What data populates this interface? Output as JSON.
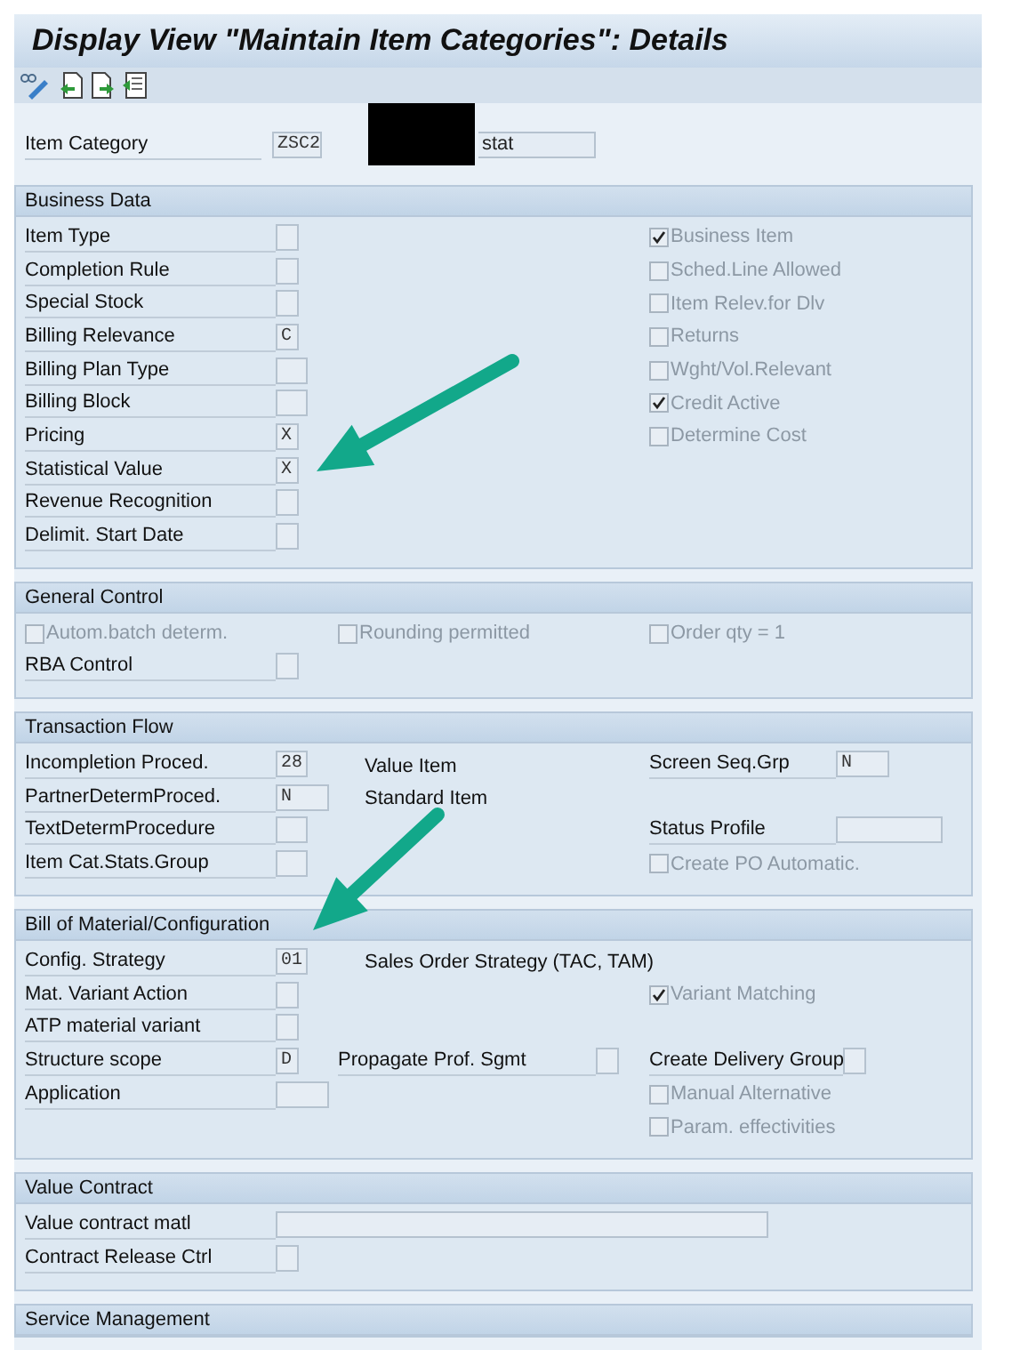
{
  "title": "Display View \"Maintain Item Categories\": Details",
  "item_category": {
    "label": "Item Category",
    "value": "ZSC2",
    "description": "stat"
  },
  "sections": [
    {
      "title": "Business Data",
      "rows": [
        {
          "left": {
            "kind": "flag",
            "label": "Item Type"
          },
          "right": {
            "kind": "checkbox",
            "label": "Business Item",
            "checked": true,
            "disabled": true
          }
        },
        {
          "left": {
            "kind": "flag",
            "label": "Completion Rule"
          },
          "right": {
            "kind": "checkbox",
            "label": "Sched.Line Allowed",
            "checked": false,
            "disabled": true
          }
        },
        {
          "left": {
            "kind": "flag",
            "label": "Special Stock"
          },
          "right": {
            "kind": "checkbox",
            "label": "Item Relev.for Dlv",
            "checked": false,
            "disabled": true
          }
        },
        {
          "left": {
            "kind": "flag",
            "label": "Billing Relevance",
            "value": "C"
          },
          "right": {
            "kind": "checkbox",
            "label": "Returns",
            "checked": false,
            "disabled": true
          }
        },
        {
          "left": {
            "kind": "code",
            "label": "Billing Plan Type"
          },
          "right": {
            "kind": "checkbox",
            "label": "Wght/Vol.Relevant",
            "checked": false,
            "disabled": true
          }
        },
        {
          "left": {
            "kind": "code",
            "label": "Billing Block"
          },
          "right": {
            "kind": "checkbox",
            "label": "Credit Active",
            "checked": true,
            "disabled": true
          }
        },
        {
          "left": {
            "kind": "flag",
            "label": "Pricing",
            "value": "X"
          },
          "right": {
            "kind": "checkbox",
            "label": "Determine Cost",
            "checked": false,
            "disabled": true
          }
        },
        {
          "left": {
            "kind": "flag",
            "label": "Statistical Value",
            "value": "X"
          }
        },
        {
          "left": {
            "kind": "flag",
            "label": "Revenue Recognition"
          }
        },
        {
          "left": {
            "kind": "flag",
            "label": "Delimit. Start Date"
          }
        }
      ]
    },
    {
      "title": "General Control",
      "rows": [
        {
          "left": {
            "kind": "checkbox",
            "label": "Autom.batch determ.",
            "checked": false,
            "disabled": true
          },
          "middle": {
            "kind": "checkbox",
            "label": "Rounding permitted",
            "checked": false,
            "disabled": true
          },
          "right": {
            "kind": "checkbox",
            "label": "Order qty = 1",
            "checked": false,
            "disabled": true
          }
        },
        {
          "left": {
            "kind": "flag",
            "label": "RBA Control"
          }
        }
      ]
    },
    {
      "title": "Transaction Flow",
      "rows": [
        {
          "left": {
            "kind": "code",
            "label": "Incompletion Proced.",
            "value": "28"
          },
          "middle": {
            "kind": "text",
            "label": "Value Item"
          },
          "right": {
            "kind": "key",
            "label": "Screen Seq.Grp",
            "value": "N"
          }
        },
        {
          "left": {
            "kind": "key",
            "label": "PartnerDetermProced.",
            "value": "N"
          },
          "middle": {
            "kind": "text",
            "label": "Standard Item"
          }
        },
        {
          "left": {
            "kind": "code",
            "label": "TextDetermProcedure"
          },
          "right": {
            "kind": "profile",
            "label": "Status Profile"
          }
        },
        {
          "left": {
            "kind": "code",
            "label": "Item Cat.Stats.Group"
          },
          "right": {
            "kind": "checkbox",
            "label": "Create PO Automatic.",
            "checked": false,
            "disabled": true
          }
        }
      ]
    },
    {
      "title": "Bill of Material/Configuration",
      "rows": [
        {
          "left": {
            "kind": "code",
            "label": "Config. Strategy",
            "value": "01"
          },
          "middle": {
            "kind": "text",
            "label": "Sales Order Strategy (TAC, TAM)"
          }
        },
        {
          "left": {
            "kind": "flag",
            "label": "Mat. Variant Action"
          },
          "right": {
            "kind": "checkbox",
            "label": "Variant Matching",
            "checked": true,
            "disabled": true
          }
        },
        {
          "left": {
            "kind": "flag",
            "label": "ATP material variant"
          }
        },
        {
          "left": {
            "kind": "flag",
            "label": "Structure scope",
            "value": "D"
          },
          "middle": {
            "kind": "flag",
            "label": "Propagate Prof. Sgmt"
          },
          "right": {
            "kind": "flag",
            "label": "Create Delivery Group"
          }
        },
        {
          "left": {
            "kind": "key",
            "label": "Application"
          },
          "right": {
            "kind": "checkbox",
            "label": "Manual Alternative",
            "checked": false,
            "disabled": true
          }
        },
        {
          "right": {
            "kind": "checkbox",
            "label": "Param. effectivities",
            "checked": false,
            "disabled": true
          }
        }
      ]
    },
    {
      "title": "Value Contract",
      "rows": [
        {
          "left": {
            "kind": "longfield",
            "label": "Value contract matl"
          }
        },
        {
          "left": {
            "kind": "flag",
            "label": "Contract Release Ctrl"
          }
        }
      ]
    },
    {
      "title": "Service Management"
    }
  ]
}
